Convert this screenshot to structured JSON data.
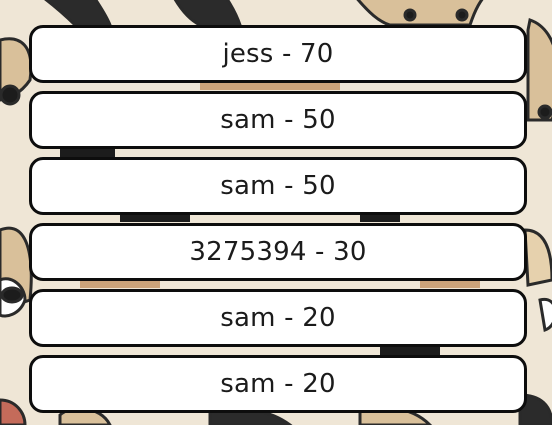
{
  "leaderboard": {
    "entries": [
      {
        "text": "jess - 70"
      },
      {
        "text": "sam - 50"
      },
      {
        "text": "sam - 50"
      },
      {
        "text": "3275394 - 30"
      },
      {
        "text": "sam - 20"
      },
      {
        "text": "sam - 20"
      }
    ]
  },
  "colors": {
    "background_cream": "#efe6d6",
    "dog_tan": "#d9c09a",
    "dog_brown": "#b88a5a",
    "dog_dark": "#1c1c1c",
    "row_fill": "#ffffff",
    "row_border": "#0d0d0d",
    "text": "#1b1b1b"
  },
  "background": {
    "pattern": "cartoon-dog-faces-icon"
  }
}
